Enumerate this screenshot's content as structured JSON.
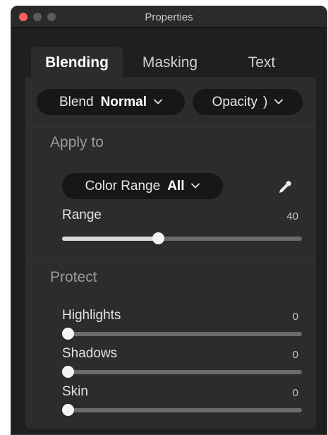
{
  "window": {
    "title": "Properties"
  },
  "tabs": [
    {
      "label": "Blending",
      "active": true
    },
    {
      "label": "Masking",
      "active": false
    },
    {
      "label": "Text",
      "active": false
    }
  ],
  "blend": {
    "label": "Blend",
    "value": "Normal"
  },
  "opacity": {
    "label": "Opacity",
    "value": ")"
  },
  "apply_to": {
    "title": "Apply to",
    "color_range": {
      "label": "Color Range",
      "value": "All"
    },
    "range": {
      "label": "Range",
      "value": "40",
      "fraction": 0.4
    }
  },
  "protect": {
    "title": "Protect",
    "sliders": [
      {
        "label": "Highlights",
        "value": "0",
        "fraction": 0
      },
      {
        "label": "Shadows",
        "value": "0",
        "fraction": 0
      },
      {
        "label": "Skin",
        "value": "0",
        "fraction": 0
      }
    ]
  },
  "icons": {
    "chevron": "chevron-down-icon",
    "picker": "eyedropper-icon"
  },
  "colors": {
    "close": "#fe5f57",
    "panel": "#2c2c2c",
    "window": "#1f1f1f"
  }
}
